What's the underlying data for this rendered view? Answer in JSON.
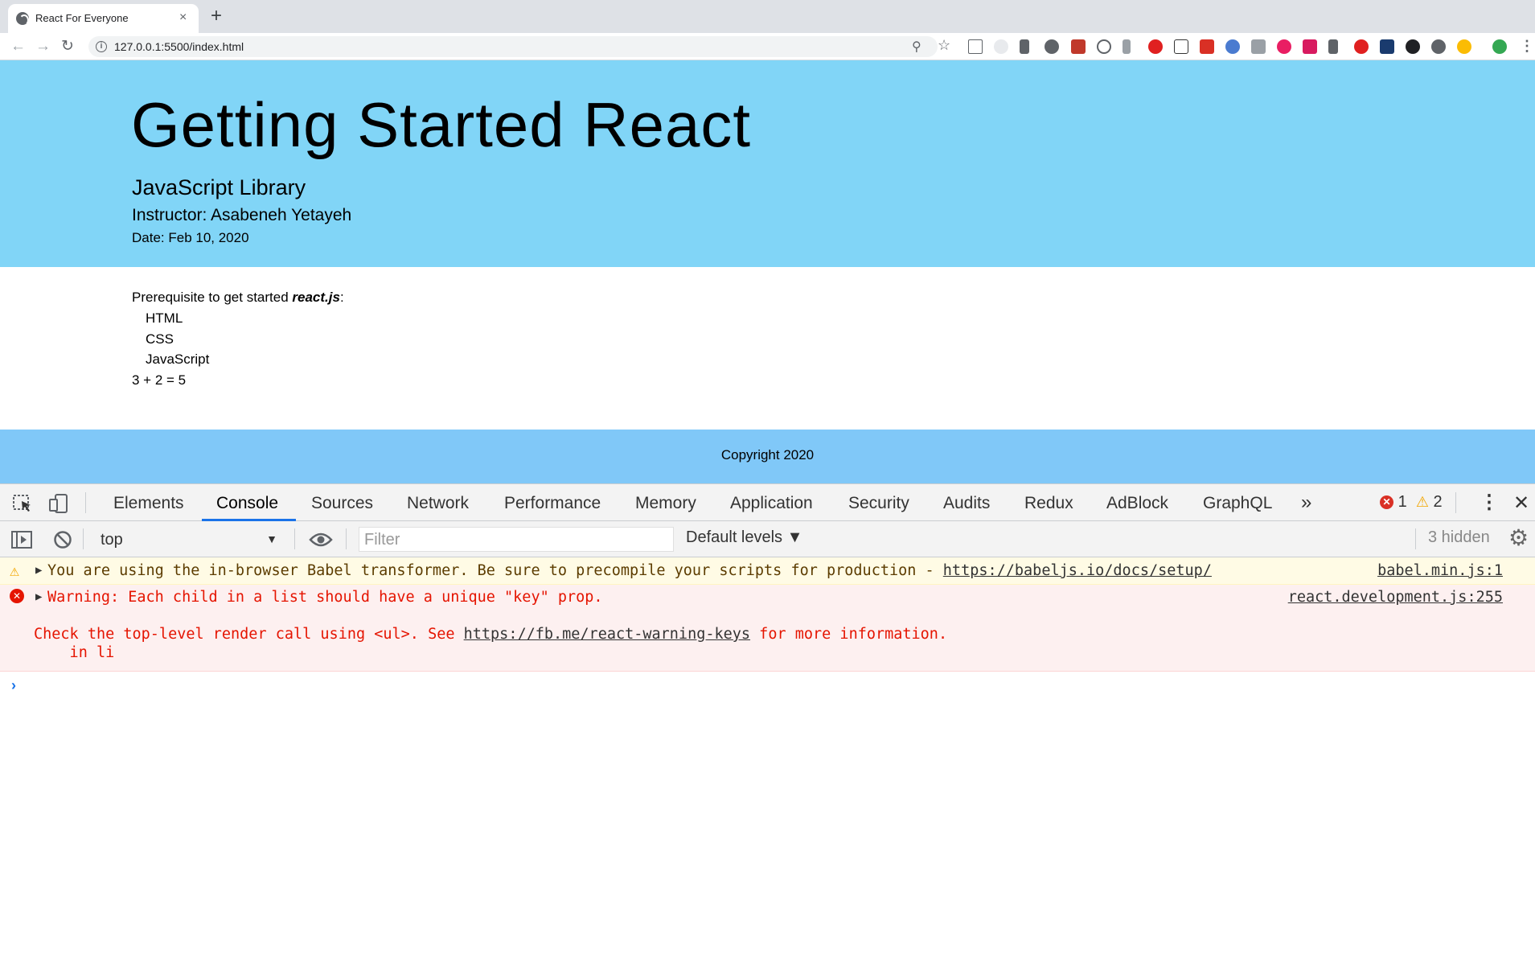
{
  "browser": {
    "tab_title": "React For Everyone",
    "tab_close": "×",
    "new_tab": "+",
    "url": "127.0.0.1:5500/index.html",
    "back": "←",
    "forward": "→",
    "reload": "↻",
    "menu": "⋮"
  },
  "header": {
    "title": "Getting Started React",
    "subtitle": "JavaScript Library",
    "instructor": "Instructor: Asabeneh Yetayeh",
    "date": "Date: Feb 10, 2020"
  },
  "main": {
    "prereq_text": "Prerequisite to get started ",
    "prereq_strong": "react.js",
    "prereq_colon": ":",
    "items": [
      "HTML",
      "CSS",
      "JavaScript"
    ],
    "sum": "3 + 2 = 5"
  },
  "footer": {
    "text": "Copyright 2020"
  },
  "devtools": {
    "tabs": [
      "Elements",
      "Console",
      "Sources",
      "Network",
      "Performance",
      "Memory",
      "Application",
      "Security",
      "Audits",
      "Redux",
      "AdBlock",
      "GraphQL"
    ],
    "active_tab": "Console",
    "more": "»",
    "error_count": "1",
    "warning_count": "2",
    "close": "✕",
    "context": "top",
    "filter_placeholder": "Filter",
    "levels": "Default levels ▼",
    "hidden": "3 hidden",
    "messages": {
      "warning": {
        "text_before": "You are using the in-browser Babel transformer. Be sure to precompile your scripts for production - ",
        "link": "https://babeljs.io/docs/setup/",
        "source": "babel.min.js:1"
      },
      "error": {
        "line1": "Warning: Each child in a list should have a unique \"key\" prop.",
        "line2_before": "Check the top-level render call using <ul>. See ",
        "line2_link": "https://fb.me/react-warning-keys",
        "line2_after": " for more information.",
        "line3": "    in li",
        "source": "react.development.js:255"
      }
    }
  },
  "colors": {
    "header_bg": "#81d5f7",
    "footer_bg": "#80c8f8",
    "error_red": "#e51400",
    "warning_bg": "#fffbe5",
    "error_bg": "#fdf0f0",
    "active_tab_blue": "#1a73e8"
  }
}
